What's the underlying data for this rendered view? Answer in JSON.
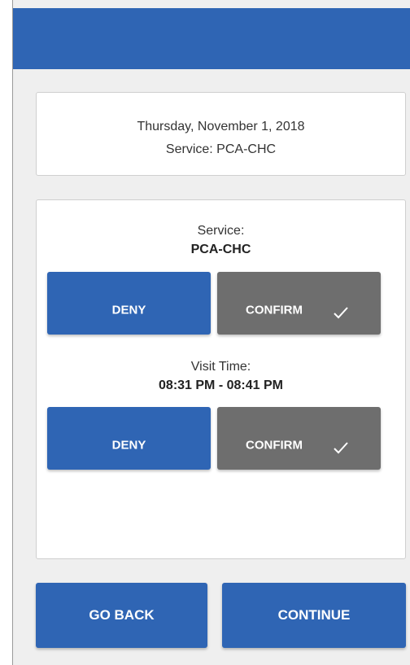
{
  "summary": {
    "date": "Thursday, November 1, 2018",
    "service": "Service: PCA-CHC"
  },
  "service_section": {
    "label": "Service:",
    "value": "PCA-CHC",
    "deny_label": "DENY",
    "confirm_label": "CONFIRM"
  },
  "visit_time_section": {
    "label": "Visit Time:",
    "value": "08:31 PM - 08:41 PM",
    "deny_label": "DENY",
    "confirm_label": "CONFIRM"
  },
  "footer": {
    "back_label": "GO BACK",
    "continue_label": "CONTINUE"
  },
  "icons": {
    "confirm_check": "checkmark-icon"
  },
  "colors": {
    "primary_blue": "#2f65b4",
    "confirm_gray": "#6e6e6e",
    "background": "#efefef"
  }
}
